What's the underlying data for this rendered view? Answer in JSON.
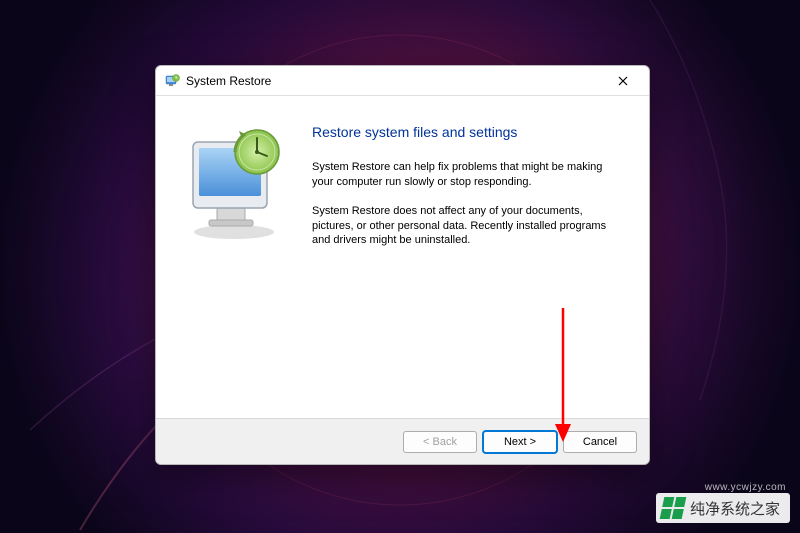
{
  "dialog": {
    "title": "System Restore",
    "heading": "Restore system files and settings",
    "paragraph1": "System Restore can help fix problems that might be making your computer run slowly or stop responding.",
    "paragraph2": "System Restore does not affect any of your documents, pictures, or other personal data. Recently installed programs and drivers might be uninstalled."
  },
  "buttons": {
    "back": "< Back",
    "next": "Next >",
    "cancel": "Cancel"
  },
  "watermark": {
    "text": "纯净系统之家",
    "url": "www.ycwjzy.com"
  }
}
